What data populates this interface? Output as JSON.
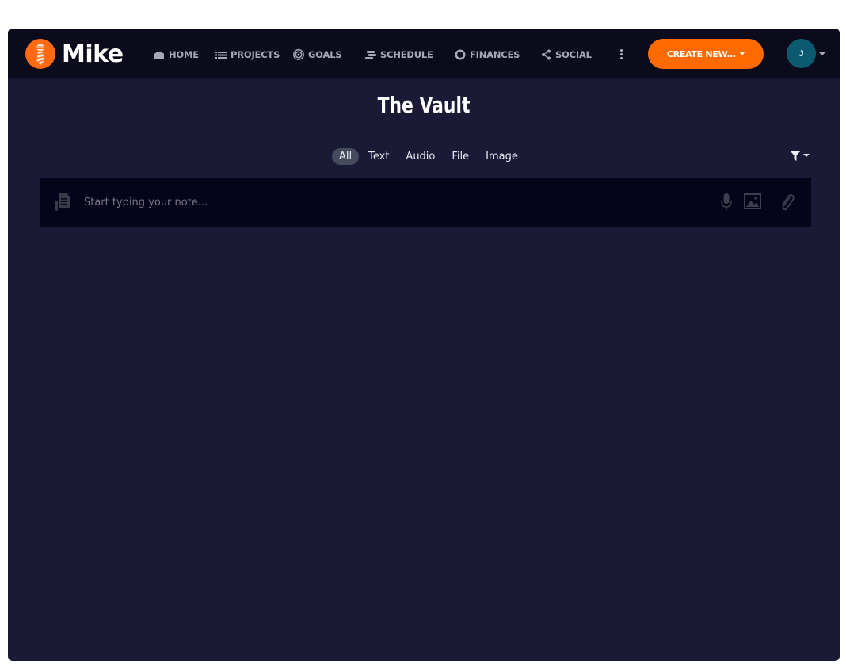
{
  "brand": {
    "name": "Mike",
    "accent": "#ff6a13"
  },
  "nav": {
    "items": [
      {
        "label": "HOME",
        "icon": "home-icon"
      },
      {
        "label": "PROJECTS",
        "icon": "list-icon"
      },
      {
        "label": "GOALS",
        "icon": "target-icon"
      },
      {
        "label": "SCHEDULE",
        "icon": "schedule-icon"
      },
      {
        "label": "FINANCES",
        "icon": "ring-icon"
      },
      {
        "label": "SOCIAL",
        "icon": "share-icon"
      }
    ],
    "more_icon": "kebab-icon",
    "create_label": "CREATE NEW...",
    "avatar_initial": "J"
  },
  "page": {
    "title": "The Vault",
    "tabs": [
      {
        "label": "All",
        "active": true
      },
      {
        "label": "Text",
        "active": false
      },
      {
        "label": "Audio",
        "active": false
      },
      {
        "label": "File",
        "active": false
      },
      {
        "label": "Image",
        "active": false
      }
    ],
    "filter_icon": "filter-icon"
  },
  "note": {
    "placeholder": "Start typing your note...",
    "value": "",
    "actions": [
      "microphone-icon",
      "image-icon",
      "paperclip-icon"
    ]
  }
}
